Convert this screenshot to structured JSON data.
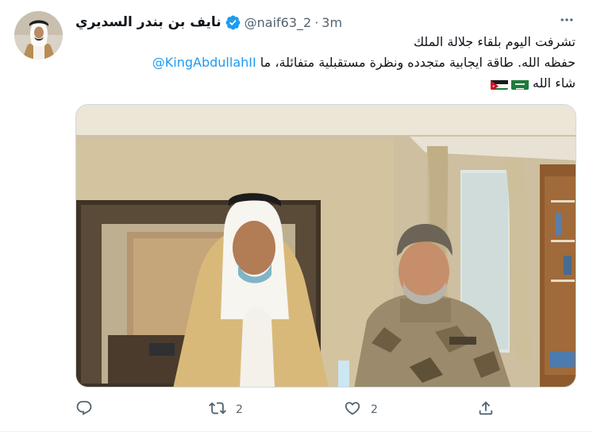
{
  "tweet": {
    "author": {
      "display_name": "نايف بن بندر السديري",
      "handle": "@naif63_2",
      "separator": "·",
      "time": "3m",
      "verified": true
    },
    "text": {
      "line1": "تشرفت اليوم بلقاء جلالة الملك",
      "line2_prefix": "حفظه الله. طاقة ايجابية متجدده ونظرة مستقبلية متفائلة، ما",
      "mention": "@KingAbdullahII",
      "line3": "شاء الله",
      "flags": [
        "saudi-flag",
        "jordan-flag"
      ]
    },
    "media": {
      "type": "photo"
    },
    "actions": {
      "reply": {
        "icon": "reply-icon",
        "count": ""
      },
      "retweet": {
        "icon": "retweet-icon",
        "count": "2"
      },
      "like": {
        "icon": "heart-icon",
        "count": "2"
      },
      "share": {
        "icon": "share-icon",
        "count": ""
      }
    },
    "colors": {
      "link": "#1d9bf0",
      "secondary_text": "#536471",
      "primary_text": "#0f1419",
      "border": "#cfd9de"
    }
  }
}
